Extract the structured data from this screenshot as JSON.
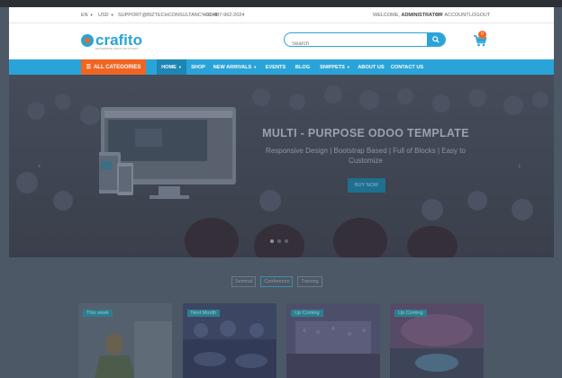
{
  "topbar": {
    "language": "EN",
    "currency": "USD",
    "email": "SUPPORT@BIZTECHCONSULTANCY.COM",
    "phone": "+91-487-962-2024",
    "welcome_prefix": "WELCOME,",
    "welcome_user": "ADMINISTRATOR",
    "my_account": "MY ACCOUNT",
    "logout": "LOGOUT"
  },
  "logo": {
    "name": "crafito",
    "tagline": "ENTERPRISE ODOO SOLUTIONS"
  },
  "search": {
    "placeholder": "Search"
  },
  "cart": {
    "count": "0"
  },
  "nav": {
    "categories": "ALL CATEGORIES",
    "items": [
      {
        "label": "HOME",
        "dropdown": true
      },
      {
        "label": "SHOP",
        "dropdown": false
      },
      {
        "label": "NEW ARRIVALS",
        "dropdown": true
      },
      {
        "label": "EVENTS",
        "dropdown": false
      },
      {
        "label": "BLOG",
        "dropdown": false
      },
      {
        "label": "SNIPPETS",
        "dropdown": true
      },
      {
        "label": "ABOUT US",
        "dropdown": false
      },
      {
        "label": "CONTACT US",
        "dropdown": false
      }
    ]
  },
  "hero": {
    "title": "MULTI - PURPOSE ODOO TEMPLATE",
    "subtitle": "Responsive Design | Bootstrap Based | Full of Blocks | Easy to Customize",
    "button": "BUY NOW"
  },
  "filters": [
    "Seminal",
    "Conference",
    "Training"
  ],
  "products": [
    {
      "tag": "This week"
    },
    {
      "tag": "Next Month"
    },
    {
      "tag": "Up Coming"
    },
    {
      "tag": "Up Coming"
    }
  ],
  "colors": {
    "accent": "#2aa4d8",
    "orange": "#f16522"
  }
}
